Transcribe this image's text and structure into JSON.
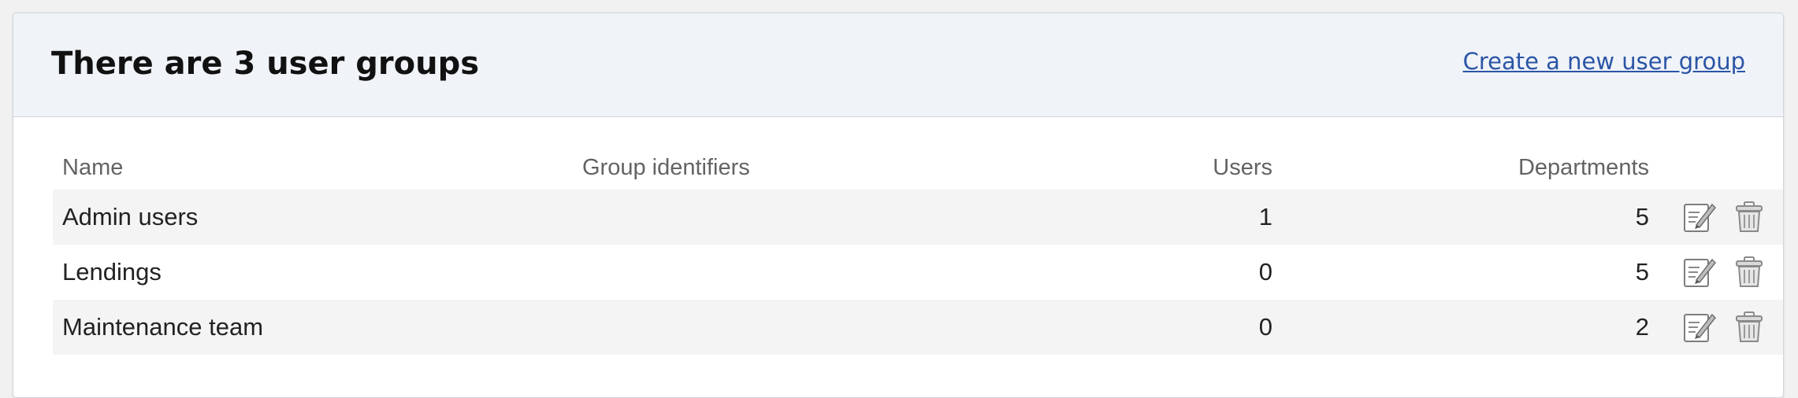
{
  "header": {
    "title": "There are 3 user groups",
    "create_link": "Create a new user group"
  },
  "table": {
    "columns": {
      "name": "Name",
      "identifiers": "Group identifiers",
      "users": "Users",
      "departments": "Departments"
    },
    "rows": [
      {
        "name": "Admin users",
        "identifiers": "",
        "users": "1",
        "departments": "5"
      },
      {
        "name": "Lendings",
        "identifiers": "",
        "users": "0",
        "departments": "5"
      },
      {
        "name": "Maintenance team",
        "identifiers": "",
        "users": "0",
        "departments": "2"
      }
    ]
  },
  "icons": {
    "edit": "edit-icon",
    "delete": "trash-icon"
  },
  "colors": {
    "link": "#2a55a6",
    "header_bg": "#f0f3f8",
    "row_alt": "#f4f4f4"
  }
}
